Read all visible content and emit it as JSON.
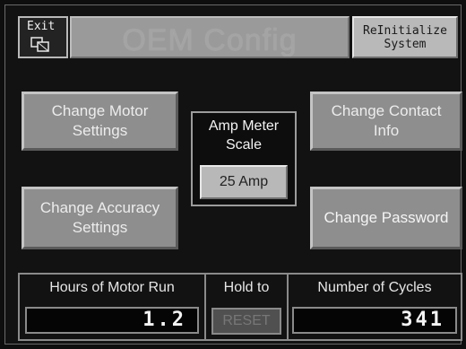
{
  "header": {
    "exit_label": "Exit",
    "title": "OEM Config",
    "reinit_line1": "ReInitialize",
    "reinit_line2": "System"
  },
  "buttons": {
    "motor": "Change Motor Settings",
    "accuracy": "Change Accuracy Settings",
    "contact": "Change Contact Info",
    "password": "Change Password"
  },
  "amp_meter": {
    "title_line1": "Amp Meter",
    "title_line2": "Scale",
    "value": "25 Amp"
  },
  "stats": {
    "hours_label": "Hours of Motor Run",
    "hours_value": "1.2",
    "hold_label": "Hold to",
    "reset_label": "RESET",
    "cycles_label": "Number of Cycles",
    "cycles_value": "341"
  },
  "colors": {
    "background": "#121212",
    "button_grey": "#8e8e8e",
    "light_button": "#b9b9b9"
  },
  "icons": {
    "exit": "exit-windows-icon"
  }
}
